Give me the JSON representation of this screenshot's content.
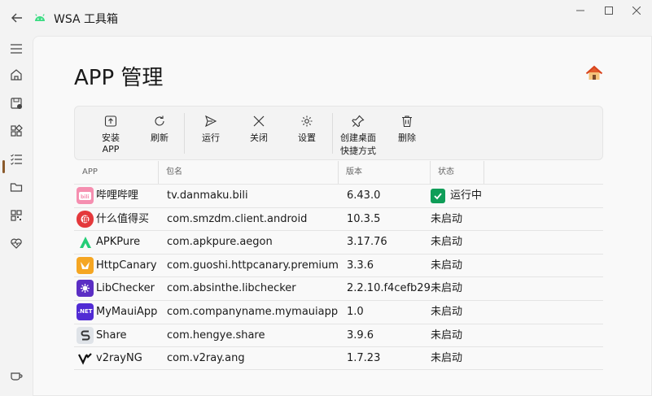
{
  "app": {
    "title": "WSA 工具箱"
  },
  "page": {
    "title": "APP 管理"
  },
  "toolbar": {
    "install": "安装 APP",
    "refresh": "刷新",
    "run": "运行",
    "close": "关闭",
    "settings": "设置",
    "shortcut_line1": "创建桌面",
    "shortcut_line2": "快捷方式",
    "delete": "删除"
  },
  "table": {
    "headers": {
      "app": "APP",
      "package": "包名",
      "version": "版本",
      "status": "状态"
    },
    "rows": [
      {
        "name": "哔哩哔哩",
        "package": "tv.danmaku.bili",
        "version": "6.43.0",
        "status": "运行中",
        "icon": "bilibili-icon",
        "icon_color": "#f58fb0",
        "running": true
      },
      {
        "name": "什么值得买",
        "package": "com.smzdm.client.android",
        "version": "10.3.5",
        "status": "未启动",
        "icon": "smzdm-icon",
        "icon_color": "#e4393c"
      },
      {
        "name": "APKPure",
        "package": "com.apkpure.aegon",
        "version": "3.17.76",
        "status": "未启动",
        "icon": "apkpure-icon",
        "icon_color": "#24cd77"
      },
      {
        "name": "HttpCanary",
        "package": "com.guoshi.httpcanary.premium",
        "version": "3.3.6",
        "status": "未启动",
        "icon": "httpcanary-icon",
        "icon_color": "#f5a623"
      },
      {
        "name": "LibChecker",
        "package": "com.absinthe.libchecker",
        "version": "2.2.10.f4cefb29",
        "status": "未启动",
        "icon": "libchecker-icon",
        "icon_color": "#5b2ec4"
      },
      {
        "name": "MyMauiApp",
        "package": "com.companyname.mymauiapp",
        "version": "1.0",
        "status": "未启动",
        "icon": "net-icon",
        "icon_color": "#512bd4",
        "icon_text": ".NET"
      },
      {
        "name": "Share",
        "package": "com.hengye.share",
        "version": "3.9.6",
        "status": "未启动",
        "icon": "share-icon",
        "icon_color": "#dfe3e8"
      },
      {
        "name": "v2rayNG",
        "package": "com.v2ray.ang",
        "version": "1.7.23",
        "status": "未启动",
        "icon": "v2rayng-icon",
        "icon_color": "#ffffff"
      }
    ]
  },
  "colors": {
    "accent": "#8a5a2b",
    "running": "#0f9d58"
  }
}
